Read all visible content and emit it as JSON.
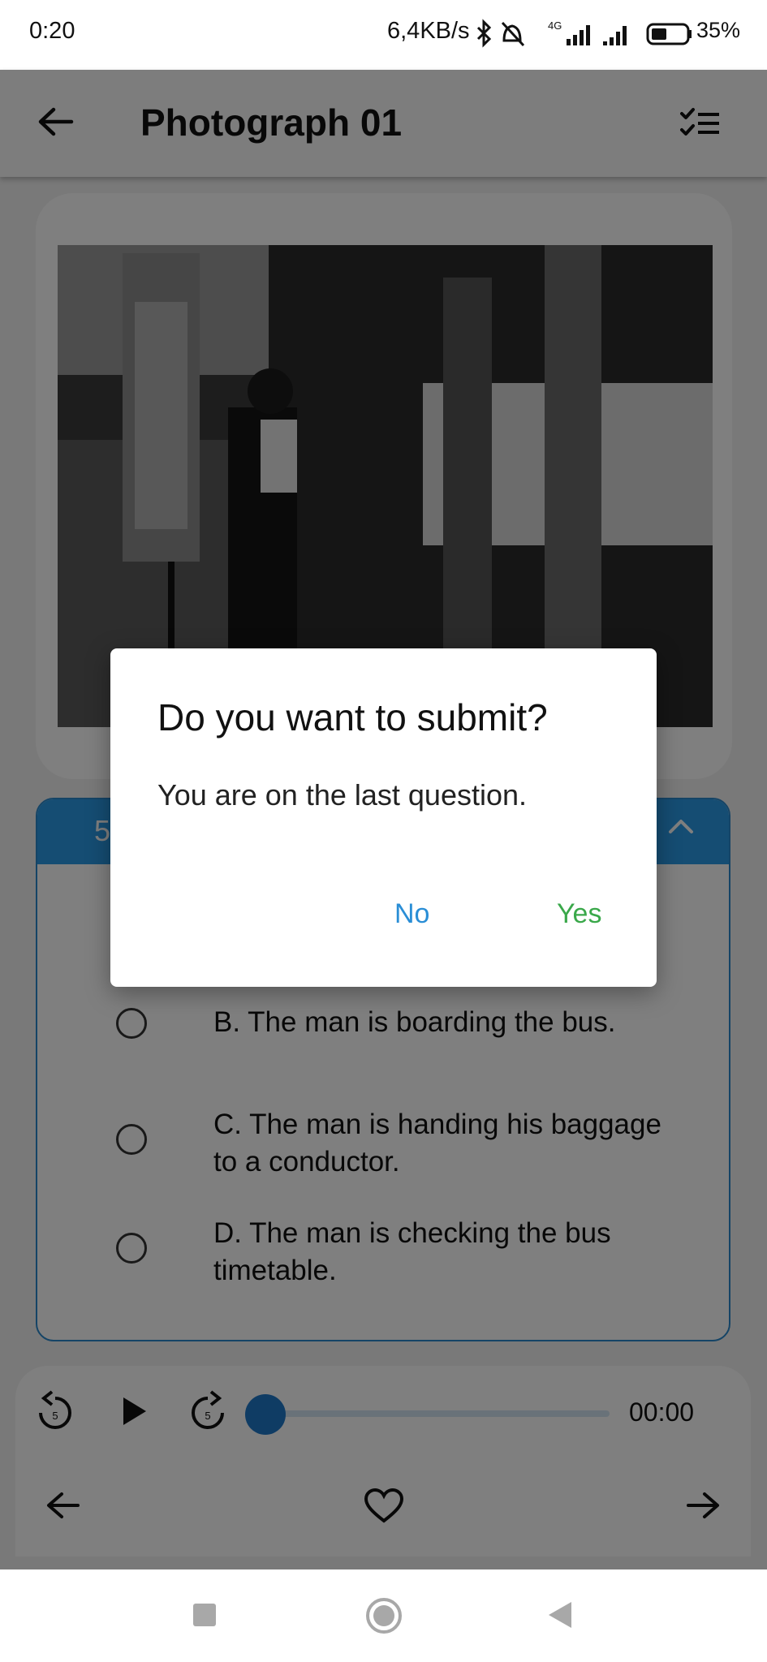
{
  "status_bar": {
    "time": "0:20",
    "network_speed": "6,4KB/s",
    "network_type": "4G",
    "battery": "35%",
    "icons": [
      "bluetooth-icon",
      "mute-icon",
      "signal-icon",
      "signal-icon",
      "battery-icon"
    ]
  },
  "app_bar": {
    "title": "Photograph 01",
    "back_icon": "arrow-left-icon",
    "list_icon": "checklist-icon"
  },
  "question": {
    "number": "5",
    "options": [
      {
        "label": "B. The man is boarding the bus."
      },
      {
        "label": "C. The man is handing his baggage to a conductor."
      },
      {
        "label": "D. The man is checking the bus timetable."
      }
    ]
  },
  "player": {
    "time": "00:00",
    "progress": 0,
    "replay_seconds": "5",
    "forward_seconds": "5"
  },
  "dialog": {
    "title": "Do you want to submit?",
    "message": "You are on the last question.",
    "no_label": "No",
    "yes_label": "Yes"
  },
  "colors": {
    "accent": "#2a9be6",
    "yes": "#3aa84a",
    "no": "#2a8ed6"
  }
}
